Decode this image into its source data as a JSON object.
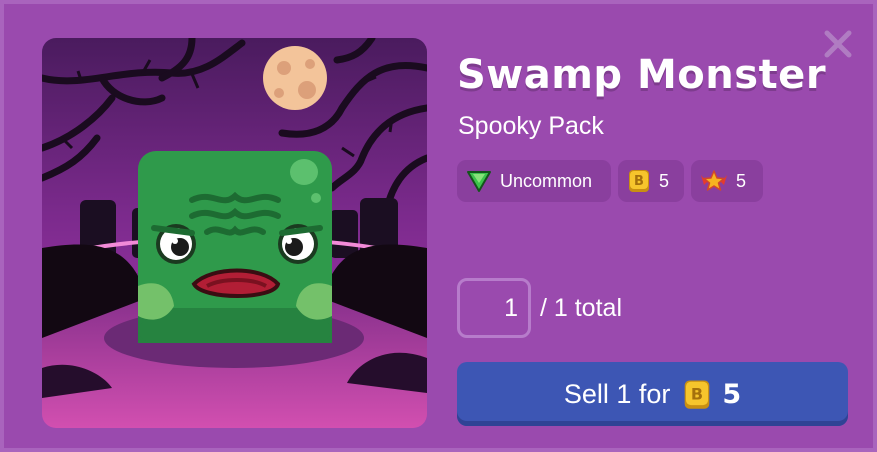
{
  "item": {
    "name": "Swamp Monster",
    "pack": "Spooky Pack",
    "rarity": "Uncommon",
    "value": "5",
    "xp": "5"
  },
  "quantity": {
    "current": "1",
    "total_text": "/ 1 total"
  },
  "sell": {
    "prefix": "Sell 1 for",
    "amount": "5"
  },
  "colors": {
    "panel": "#9a4aae",
    "chip": "#8a3f9e",
    "sell_button": "#3d56b4",
    "monster_green": "#2f9a4b"
  },
  "icons": {
    "close": "close-icon",
    "rarity": "green-gem-icon",
    "value": "token-icon",
    "xp": "star-icon"
  }
}
